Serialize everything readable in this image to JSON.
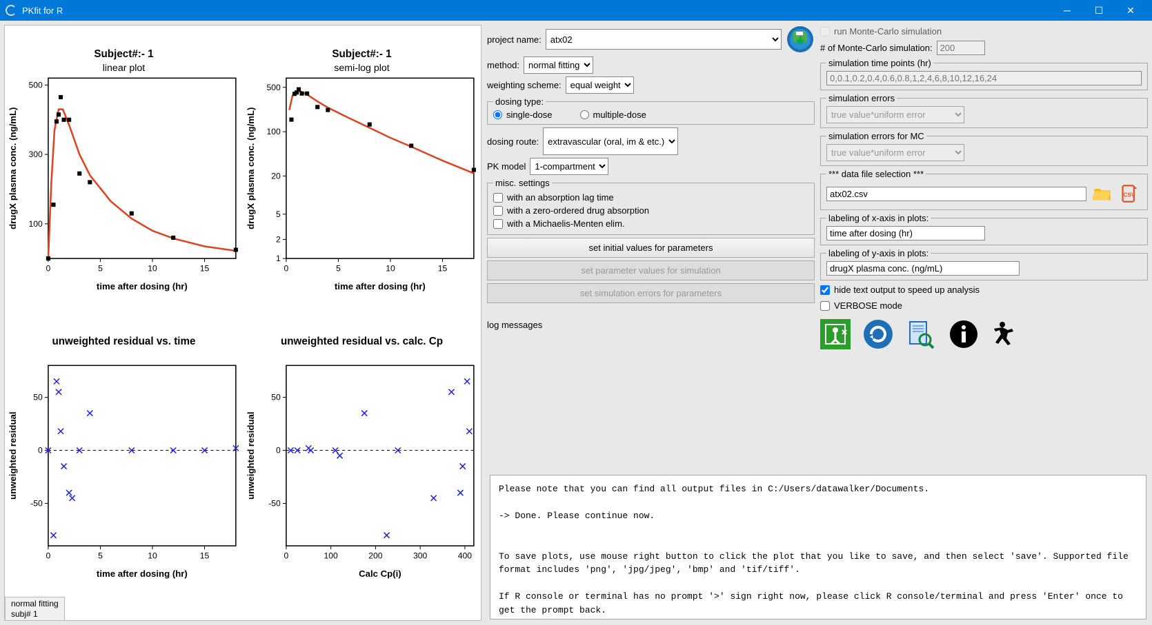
{
  "window": {
    "title": "PKfit for R"
  },
  "plot_tab": "normal fitting\nsubj# 1",
  "chart_data": [
    {
      "type": "line+scatter",
      "title": "Subject#:-  1",
      "subtitle": "linear plot",
      "xlabel": "time after dosing (hr)",
      "ylabel": "drugX plasma conc. (ng/mL)",
      "xlim": [
        0,
        18
      ],
      "ylim": [
        0,
        520
      ],
      "xticks": [
        0,
        5,
        10,
        15
      ],
      "yticks": [
        100,
        300,
        500
      ],
      "points": [
        {
          "x": 0,
          "y": 0
        },
        {
          "x": 0.5,
          "y": 155
        },
        {
          "x": 0.8,
          "y": 395
        },
        {
          "x": 1,
          "y": 415
        },
        {
          "x": 1.2,
          "y": 465
        },
        {
          "x": 1.5,
          "y": 400
        },
        {
          "x": 2,
          "y": 400
        },
        {
          "x": 3,
          "y": 245
        },
        {
          "x": 4,
          "y": 220
        },
        {
          "x": 8,
          "y": 130
        },
        {
          "x": 12,
          "y": 60
        },
        {
          "x": 18,
          "y": 25
        }
      ],
      "curve": [
        {
          "x": 0,
          "y": 0
        },
        {
          "x": 0.3,
          "y": 220
        },
        {
          "x": 0.6,
          "y": 370
        },
        {
          "x": 1,
          "y": 430
        },
        {
          "x": 1.4,
          "y": 430
        },
        {
          "x": 2,
          "y": 385
        },
        {
          "x": 3,
          "y": 300
        },
        {
          "x": 4,
          "y": 240
        },
        {
          "x": 6,
          "y": 165
        },
        {
          "x": 8,
          "y": 115
        },
        {
          "x": 10,
          "y": 80
        },
        {
          "x": 12,
          "y": 58
        },
        {
          "x": 15,
          "y": 35
        },
        {
          "x": 18,
          "y": 22
        }
      ]
    },
    {
      "type": "line+scatter",
      "title": "Subject#:-  1",
      "subtitle": "semi-log plot",
      "xlabel": "time after dosing (hr)",
      "ylabel": "drugX plasma conc. (ng/mL)",
      "xlim": [
        0,
        18
      ],
      "ylim_log": [
        1,
        700
      ],
      "xticks": [
        0,
        5,
        10,
        15
      ],
      "yticks_log": [
        1,
        2,
        5,
        20,
        100,
        500
      ],
      "points": [
        {
          "x": 0.5,
          "y": 155
        },
        {
          "x": 0.8,
          "y": 395
        },
        {
          "x": 1,
          "y": 415
        },
        {
          "x": 1.2,
          "y": 465
        },
        {
          "x": 1.5,
          "y": 400
        },
        {
          "x": 2,
          "y": 400
        },
        {
          "x": 3,
          "y": 245
        },
        {
          "x": 4,
          "y": 220
        },
        {
          "x": 8,
          "y": 130
        },
        {
          "x": 12,
          "y": 60
        },
        {
          "x": 18,
          "y": 25
        }
      ],
      "curve": [
        {
          "x": 0.3,
          "y": 220
        },
        {
          "x": 0.6,
          "y": 370
        },
        {
          "x": 1,
          "y": 430
        },
        {
          "x": 1.4,
          "y": 430
        },
        {
          "x": 2,
          "y": 385
        },
        {
          "x": 3,
          "y": 300
        },
        {
          "x": 4,
          "y": 240
        },
        {
          "x": 6,
          "y": 165
        },
        {
          "x": 8,
          "y": 115
        },
        {
          "x": 10,
          "y": 80
        },
        {
          "x": 12,
          "y": 58
        },
        {
          "x": 15,
          "y": 35
        },
        {
          "x": 18,
          "y": 22
        }
      ]
    },
    {
      "type": "scatter",
      "title": "unweighted residual vs. time",
      "xlabel": "time after dosing (hr)",
      "ylabel": "unweighted residual",
      "xlim": [
        0,
        18
      ],
      "ylim": [
        -90,
        80
      ],
      "xticks": [
        0,
        5,
        10,
        15
      ],
      "yticks": [
        -50,
        0,
        50
      ],
      "points": [
        {
          "x": 0,
          "y": 0
        },
        {
          "x": 0.5,
          "y": -80
        },
        {
          "x": 0.8,
          "y": 65
        },
        {
          "x": 1,
          "y": 55
        },
        {
          "x": 1.2,
          "y": 18
        },
        {
          "x": 1.5,
          "y": -15
        },
        {
          "x": 2,
          "y": -40
        },
        {
          "x": 2.3,
          "y": -45
        },
        {
          "x": 3,
          "y": 0
        },
        {
          "x": 4,
          "y": 35
        },
        {
          "x": 8,
          "y": 0
        },
        {
          "x": 12,
          "y": 0
        },
        {
          "x": 15,
          "y": 0
        },
        {
          "x": 18,
          "y": 2
        }
      ],
      "hline": 0
    },
    {
      "type": "scatter",
      "title": "unweighted residual vs. calc. Cp",
      "xlabel": "Calc Cp(i)",
      "ylabel": "unweighted residual",
      "xlim": [
        0,
        420
      ],
      "ylim": [
        -90,
        80
      ],
      "xticks": [
        0,
        100,
        200,
        300,
        400
      ],
      "yticks": [
        -50,
        0,
        50
      ],
      "points": [
        {
          "x": 10,
          "y": 0
        },
        {
          "x": 25,
          "y": 0
        },
        {
          "x": 50,
          "y": 2
        },
        {
          "x": 55,
          "y": 0
        },
        {
          "x": 110,
          "y": 0
        },
        {
          "x": 120,
          "y": -5
        },
        {
          "x": 175,
          "y": 35
        },
        {
          "x": 225,
          "y": -80
        },
        {
          "x": 250,
          "y": 0
        },
        {
          "x": 330,
          "y": -45
        },
        {
          "x": 370,
          "y": 55
        },
        {
          "x": 390,
          "y": -40
        },
        {
          "x": 395,
          "y": -15
        },
        {
          "x": 405,
          "y": 65
        },
        {
          "x": 410,
          "y": 18
        }
      ],
      "hline": 0
    }
  ],
  "left": {
    "project_name_label": "project name:",
    "project_name": "atx02",
    "method_label": "method:",
    "method": "normal fitting",
    "weight_label": "weighting scheme:",
    "weight": "equal weight",
    "dosing_type_label": "dosing type:",
    "dosing_single": "single-dose",
    "dosing_multiple": "multiple-dose",
    "dosing_route_label": "dosing route:",
    "dosing_route": "extravascular\n(oral, im & etc.)",
    "pk_model_label": "PK model",
    "pk_model": "1-compartment",
    "misc_legend": "misc. settings",
    "misc_lag": "with an absorption lag time",
    "misc_zero": "with a zero-ordered drug absorption",
    "misc_mm": "with a Michaelis-Menten elim.",
    "btn_init": "set initial values for parameters",
    "btn_simparam": "set parameter values for simulation",
    "btn_simerr": "set simulation errors for parameters"
  },
  "right": {
    "run_mc": "run Monte-Carlo simulation",
    "mc_count_label": "# of Monte-Carlo simulation:",
    "mc_count": "200",
    "sim_tp_label": "simulation time points (hr)",
    "sim_tp": "0,0.1,0.2,0.4,0.6,0.8,1,2,4,6,8,10,12,16,24",
    "sim_err_label": "simulation errors",
    "sim_err": "true value*uniform error",
    "sim_err_mc_label": "simulation errors for MC",
    "sim_err_mc": "true value*uniform error",
    "file_label": "*** data file selection ***",
    "file": "atx02.csv",
    "xlab_label": "labeling of x-axis in plots:",
    "xlab": "time after dosing (hr)",
    "ylab_label": "labeling of y-axis in plots:",
    "ylab": "drugX plasma conc. (ng/mL)",
    "hide_output": "hide text output to speed up analysis",
    "verbose": "VERBOSE mode"
  },
  "log": {
    "label": "log messages",
    "text": "Please note that you can find all output files in C:/Users/datawalker/Documents.\n\n-> Done. Please continue now.\n\n\nTo save plots, use mouse right button to click the plot that you like to save, and then select 'save'. Supported file format includes 'png', 'jpg/jpeg', 'bmp' and 'tif/tiff'.\n\nIf R console or terminal has no prompt '>' sign right now, please click R console/terminal and press 'Enter' once to get the prompt back."
  }
}
